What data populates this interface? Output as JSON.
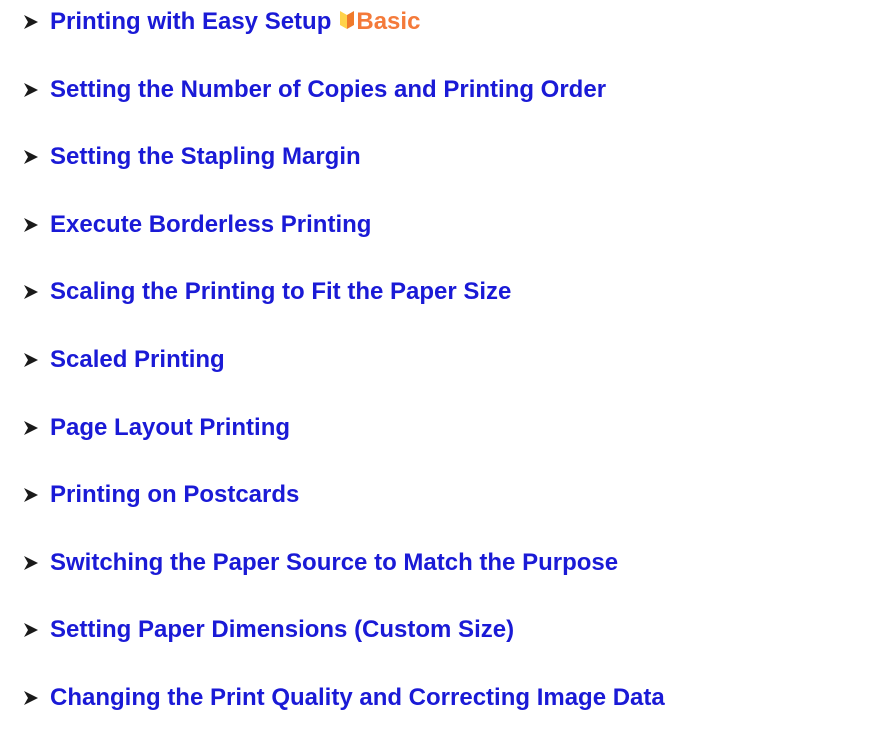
{
  "colors": {
    "link": "#1a1ad6",
    "bullet": "#1a1a1a",
    "badge_text": "#f47a3a",
    "badge_icon_top": "#ffd24a",
    "badge_icon_bottom": "#f07a2a"
  },
  "links": [
    {
      "label": "Printing with Easy Setup",
      "badge": "Basic",
      "badge_icon": "beginner-mark-icon"
    },
    {
      "label": "Setting the Number of Copies and Printing Order"
    },
    {
      "label": "Setting the Stapling Margin"
    },
    {
      "label": "Execute Borderless Printing"
    },
    {
      "label": "Scaling the Printing to Fit the Paper Size"
    },
    {
      "label": "Scaled Printing"
    },
    {
      "label": "Page Layout Printing"
    },
    {
      "label": "Printing on Postcards"
    },
    {
      "label": "Switching the Paper Source to Match the Purpose"
    },
    {
      "label": "Setting Paper Dimensions (Custom Size)"
    },
    {
      "label": "Changing the Print Quality and Correcting Image Data"
    }
  ]
}
